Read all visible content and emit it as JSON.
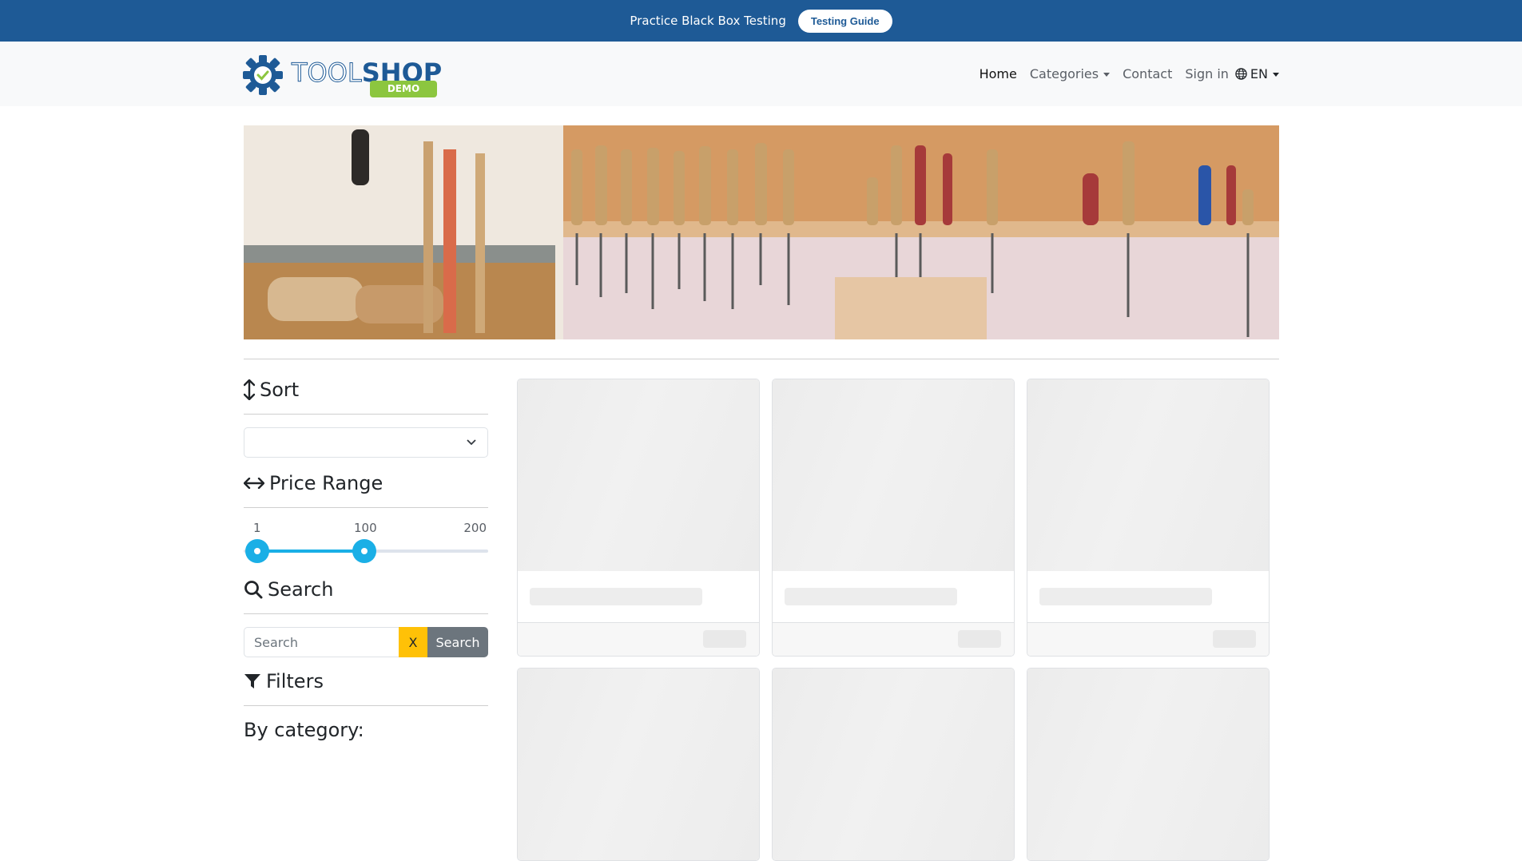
{
  "promo": {
    "text": "Practice Black Box Testing",
    "button_label": "Testing Guide"
  },
  "logo": {
    "word_tool": "TOOL",
    "word_shop": "SHOP",
    "badge": "DEMO"
  },
  "nav": {
    "home": "Home",
    "categories": "Categories",
    "contact": "Contact",
    "sign_in": "Sign in",
    "language": "EN"
  },
  "sidebar": {
    "sort_title": "Sort",
    "sort_selected": "",
    "price_title": "Price Range",
    "price_min_label": "1",
    "price_max_label": "200",
    "price_selected_low": 1,
    "price_selected_high": 100,
    "price_high_label": "100",
    "search_title": "Search",
    "search_placeholder": "Search",
    "clear_label": "X",
    "search_button": "Search",
    "filters_title": "Filters",
    "by_category": "By category:"
  },
  "colors": {
    "promo_bg": "#1e5a96",
    "slider_accent": "#1aafe6",
    "clear_button": "#ffc107",
    "search_button": "#6c757d",
    "demo_badge": "#8cc63f"
  },
  "products": {
    "loading": true,
    "placeholder_cards": 6
  }
}
